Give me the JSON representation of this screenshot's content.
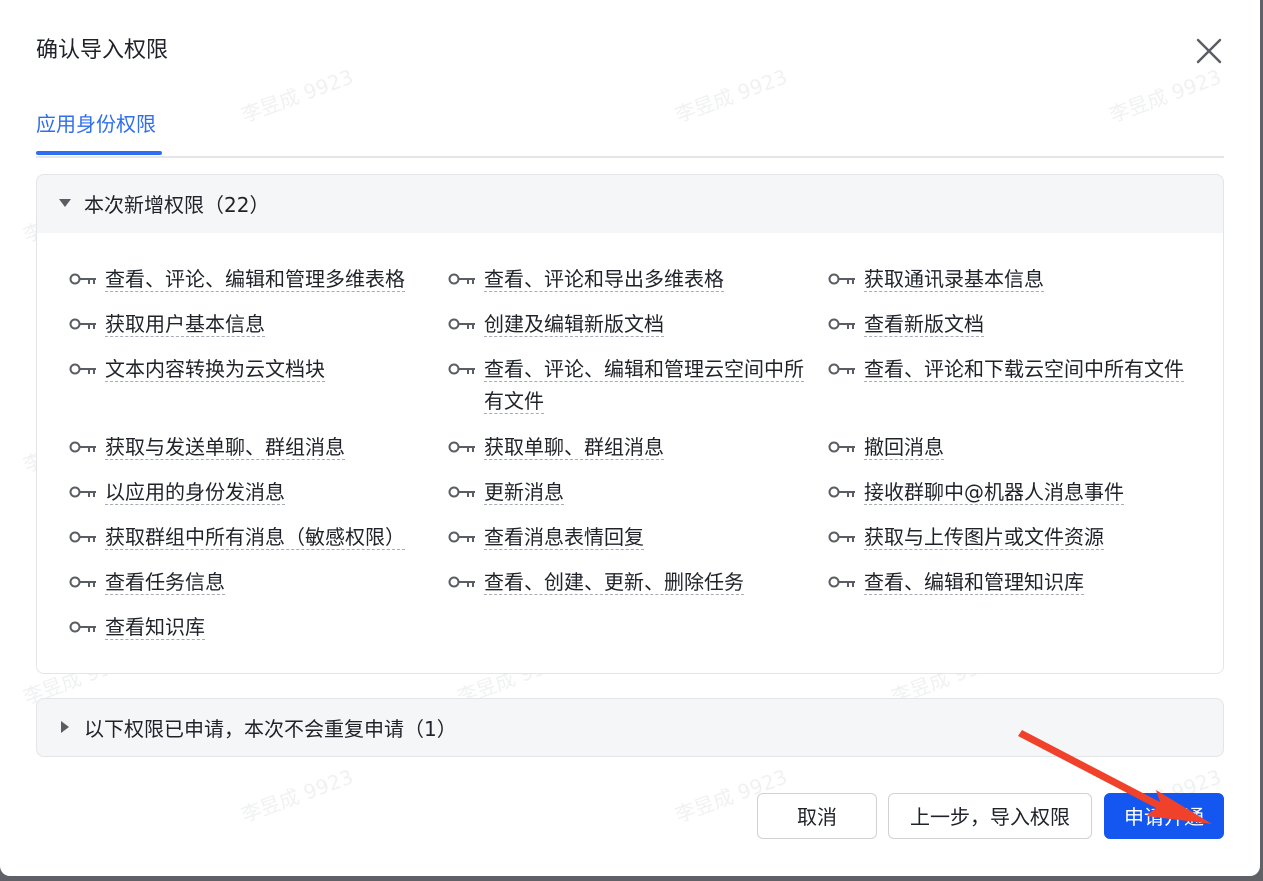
{
  "dialog": {
    "title": "确认导入权限",
    "close_icon": "close-icon"
  },
  "tabs": [
    {
      "label": "应用身份权限"
    }
  ],
  "new_permissions": {
    "header": "本次新增权限（22）",
    "items": [
      {
        "label": "查看、评论、编辑和管理多维表格"
      },
      {
        "label": "查看、评论和导出多维表格"
      },
      {
        "label": "获取通讯录基本信息"
      },
      {
        "label": "获取用户基本信息"
      },
      {
        "label": "创建及编辑新版文档"
      },
      {
        "label": "查看新版文档"
      },
      {
        "label": "文本内容转换为云文档块"
      },
      {
        "label": "查看、评论、编辑和管理云空间中所有文件"
      },
      {
        "label": "查看、评论和下载云空间中所有文件"
      },
      {
        "label": "获取与发送单聊、群组消息"
      },
      {
        "label": "获取单聊、群组消息"
      },
      {
        "label": "撤回消息"
      },
      {
        "label": "以应用的身份发消息"
      },
      {
        "label": "更新消息"
      },
      {
        "label": "接收群聊中@机器人消息事件"
      },
      {
        "label": "获取群组中所有消息（敏感权限）"
      },
      {
        "label": "查看消息表情回复"
      },
      {
        "label": "获取与上传图片或文件资源"
      },
      {
        "label": "查看任务信息"
      },
      {
        "label": "查看、创建、更新、删除任务"
      },
      {
        "label": "查看、编辑和管理知识库"
      },
      {
        "label": "查看知识库"
      }
    ]
  },
  "existing_permissions": {
    "header": "以下权限已申请，本次不会重复申请（1）"
  },
  "footer": {
    "cancel_label": "取消",
    "back_label": "上一步，导入权限",
    "submit_label": "申请开通"
  },
  "watermark": "李昱成 9923",
  "colors": {
    "primary": "#1456f0",
    "tab_active": "#2f6fef",
    "arrow": "#f0412a"
  }
}
